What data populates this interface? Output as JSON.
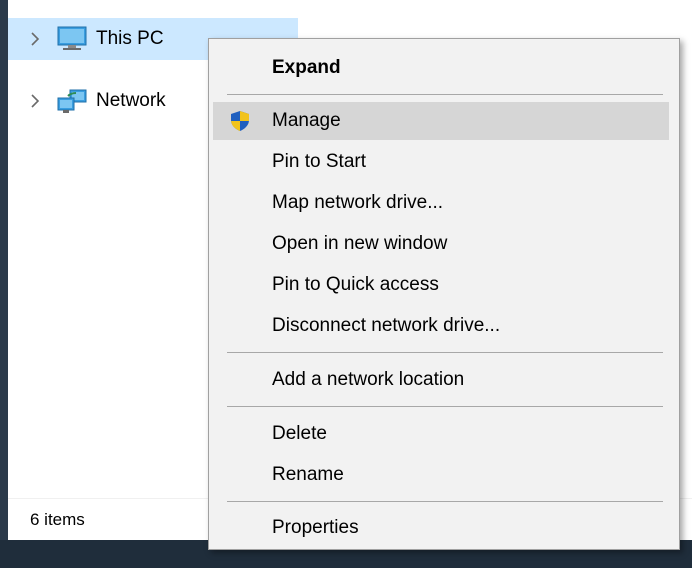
{
  "navigation": {
    "items": [
      {
        "label": "This PC",
        "icon": "computer-icon",
        "selected": true
      },
      {
        "label": "Network",
        "icon": "network-icon",
        "selected": false
      }
    ]
  },
  "status_bar": {
    "item_count": "6 items"
  },
  "context_menu": {
    "items": [
      {
        "label": "Expand",
        "bold": true
      },
      {
        "label": "Manage",
        "icon": "uac-shield-icon",
        "highlighted": true
      },
      {
        "label": "Pin to Start"
      },
      {
        "label": "Map network drive..."
      },
      {
        "label": "Open in new window"
      },
      {
        "label": "Pin to Quick access"
      },
      {
        "label": "Disconnect network drive..."
      },
      {
        "label": "Add a network location"
      },
      {
        "label": "Delete"
      },
      {
        "label": "Rename"
      },
      {
        "label": "Properties"
      }
    ]
  },
  "colors": {
    "selection": "#cce8ff",
    "menu_background": "#f2f2f2",
    "menu_highlight": "#d6d6d6"
  }
}
